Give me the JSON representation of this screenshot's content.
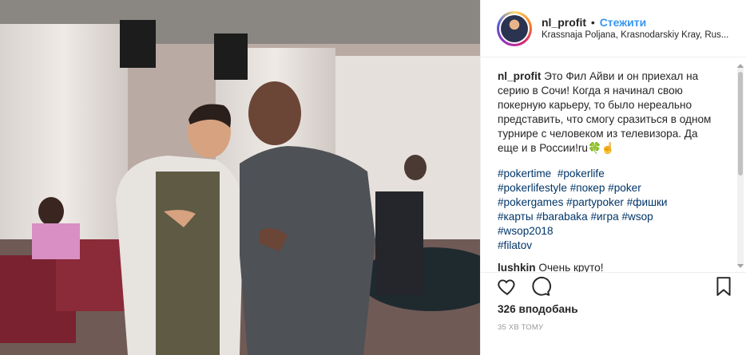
{
  "header": {
    "username": "nl_profit",
    "separator": "•",
    "follow_label": "Стежити",
    "location": "Krassnaja Poljana, Krasnodarskiy Kray, Rus..."
  },
  "caption": {
    "username": "nl_profit",
    "text": "Это Фил Айви и он приехал на серию в Сочи! Когда я начинал свою покерную карьеру, то было нереально представить, что смогу  сразиться в одном турнире с человеком из телевизора. Да еще и в России!ru🍀☝"
  },
  "hashtags": [
    "#pokertime",
    "#pokerlife",
    "#pokerlifestyle",
    "#покер",
    "#poker",
    "#pokergames",
    "#partypoker",
    "#фишки",
    "#карты",
    "#barabaka",
    "#игра",
    "#wsop",
    "#wsop2018",
    "#filatov"
  ],
  "next_comment": {
    "username": "lushkin",
    "text": "Очень круто!"
  },
  "actions": {
    "likes": "326 вподобань",
    "time": "35 ХВ ТОМУ",
    "icons": [
      "heart-icon",
      "comment-icon",
      "bookmark-icon"
    ]
  },
  "colors": {
    "link": "#3897f0",
    "hashtag": "#003569",
    "text": "#262626",
    "muted": "#999999"
  }
}
